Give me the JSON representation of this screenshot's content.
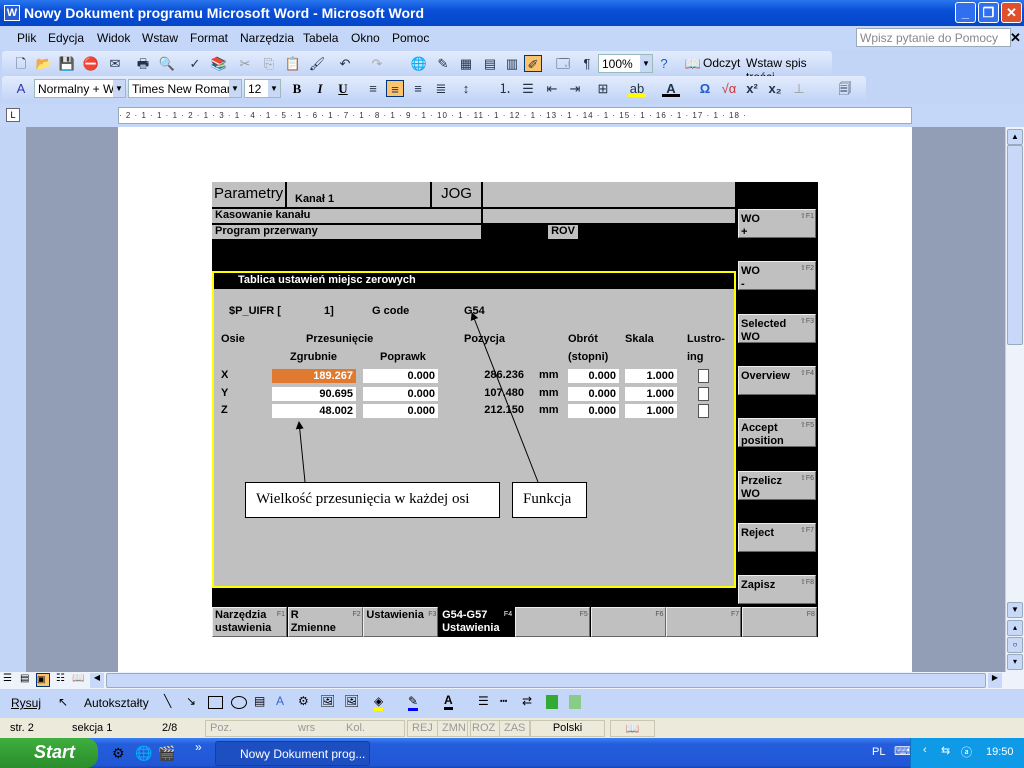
{
  "window": {
    "title": "Nowy Dokument programu Microsoft Word - Microsoft Word",
    "app_icon": "word-icon"
  },
  "menu": {
    "items": [
      "Plik",
      "Edycja",
      "Widok",
      "Wstaw",
      "Format",
      "Narzędzia",
      "Tabela",
      "Okno",
      "Pomoc"
    ],
    "help_placeholder": "Wpisz pytanie do Pomocy"
  },
  "toolbar": {
    "zoom": "100%",
    "reading": "Odczyt",
    "toc": "Wstaw spis treści",
    "style": "Normalny + Wy",
    "font": "Times New Roman",
    "size": "12",
    "bold": "B",
    "italic": "I",
    "underline": "U"
  },
  "ruler": {
    "text": "· 2 · 1 · 1 · 1 · 2 · 1 · 3 · 1 · 4 · 1 · 5 · 1 · 6 · 1 · 7 · 1 · 8 · 1 · 9 · 1 · 10 · 1 · 11 · 1 · 12 · 1 · 13 · 1 · 14 · 1 · 15 · 1 · 16 · 1 · 17 · 1 · 18 ·"
  },
  "cnc": {
    "header": {
      "area": "Parametry",
      "channel": "Kanał 1",
      "mode": "JOG"
    },
    "status1": "Kasowanie kanału",
    "status2": "Program przerwany",
    "rov": "ROV",
    "panel_title": "Tablica ustawień miejsc zerowych",
    "uifr_label": "$P_UIFR  [",
    "uifr_index": "1]",
    "gcode_label": "G code",
    "gcode_value": "G54",
    "cols": {
      "axes": "Osie",
      "offset": "Przesunięcie",
      "coarse": "Zgrubnie",
      "fine": "Poprawk",
      "position": "Pozycja",
      "rotation": "Obrót",
      "rotation_unit": "(stopni)",
      "scale": "Skala",
      "mirror1": "Lustro-",
      "mirror2": "ing"
    },
    "rows": [
      {
        "axis": "X",
        "coarse": "189.267",
        "fine": "0.000",
        "position": "286.236",
        "unit": "mm",
        "rotation": "0.000",
        "scale": "1.000",
        "mirror": false
      },
      {
        "axis": "Y",
        "coarse": "90.695",
        "fine": "0.000",
        "position": "107.480",
        "unit": "mm",
        "rotation": "0.000",
        "scale": "1.000",
        "mirror": false
      },
      {
        "axis": "Z",
        "coarse": "48.002",
        "fine": "0.000",
        "position": "212.150",
        "unit": "mm",
        "rotation": "0.000",
        "scale": "1.000",
        "mirror": false
      }
    ],
    "vsoftkeys": [
      {
        "l1": "WO",
        "l2": "+",
        "key": "⇧F1"
      },
      {
        "l1": "WO",
        "l2": "-",
        "key": "⇧F2"
      },
      {
        "l1": "Selected",
        "l2": "WO",
        "key": "⇧F3"
      },
      {
        "l1": "Overview",
        "l2": "",
        "key": "⇧F4"
      },
      {
        "l1": "Accept",
        "l2": "position",
        "key": "⇧F5"
      },
      {
        "l1": "Przelicz",
        "l2": "WO",
        "key": "⇧F6"
      },
      {
        "l1": "Reject",
        "l2": "",
        "key": "⇧F7"
      },
      {
        "l1": "Zapisz",
        "l2": "",
        "key": "⇧F8"
      }
    ],
    "hsoftkeys": [
      {
        "l1": "Narzędzia",
        "l2": "ustawienia",
        "key": "F1"
      },
      {
        "l1": "R",
        "l2": "Zmienne",
        "key": "F2"
      },
      {
        "l1": "Ustawienia",
        "l2": "",
        "key": "F3"
      },
      {
        "l1": "G54-G57",
        "l2": "Ustawienia",
        "key": "F4",
        "active": true
      },
      {
        "l1": "",
        "l2": "",
        "key": "F5"
      },
      {
        "l1": "",
        "l2": "",
        "key": "F6"
      },
      {
        "l1": "",
        "l2": "",
        "key": "F7"
      },
      {
        "l1": "",
        "l2": "",
        "key": "F8"
      }
    ],
    "accent_color": "#e07a30",
    "frame_color": "#ffff00"
  },
  "callouts": {
    "offset": "Wielkość przesunięcia w każdej osi",
    "function": "Funkcja"
  },
  "drawbar": {
    "draw": "Rysuj",
    "autoshapes": "Autokształty"
  },
  "status": {
    "page": "str. 2",
    "section": "sekcja 1",
    "pages": "2/8",
    "pos": "Poz.",
    "line": "wrs",
    "col": "Kol.",
    "rec": "REJ",
    "trk": "ZMN",
    "ext": "ROZ",
    "ovr": "ZAS",
    "lang": "Polski"
  },
  "taskbar": {
    "start": "Start",
    "task": "Nowy Dokument prog...",
    "lang": "PL",
    "clock": "19:50"
  }
}
